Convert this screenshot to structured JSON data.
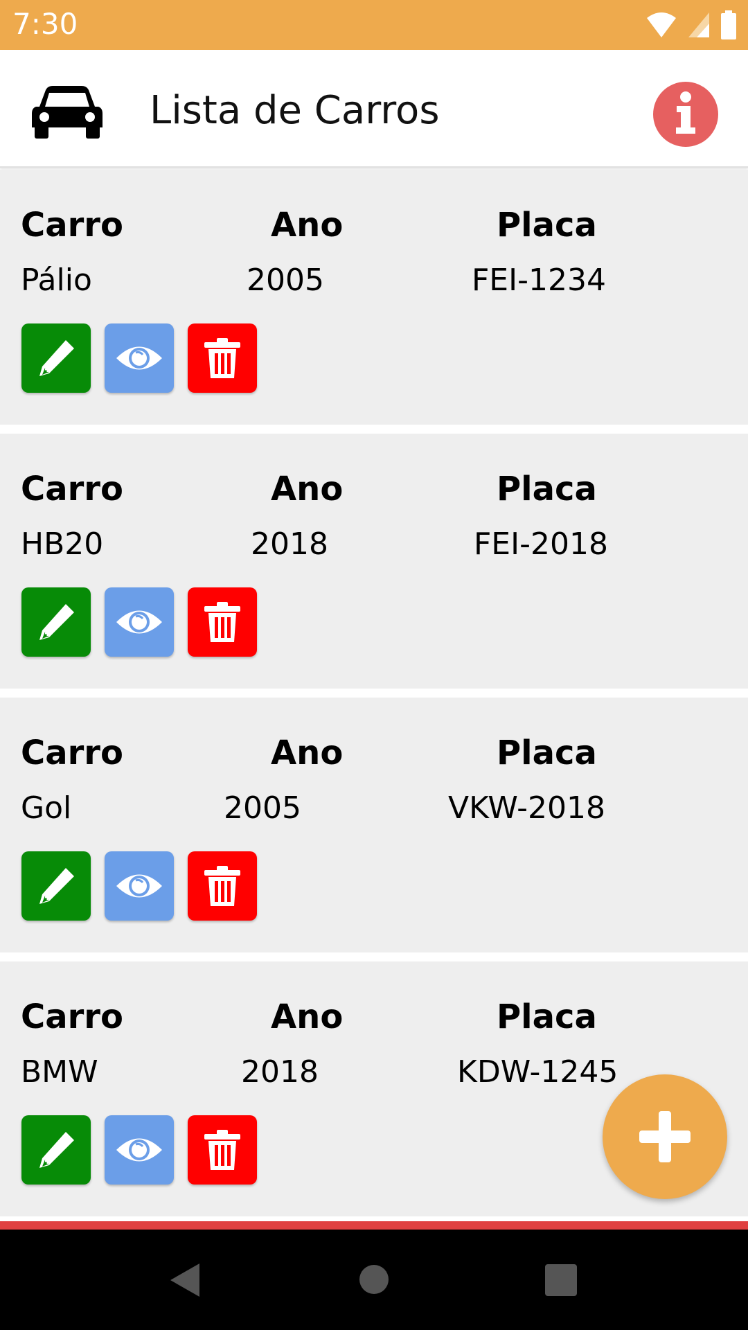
{
  "status_bar": {
    "time": "7:30"
  },
  "app_bar": {
    "title": "Lista de Carros"
  },
  "headers": {
    "car": "Carro",
    "year": "Ano",
    "plate": "Placa"
  },
  "cars": [
    {
      "car": "Pálio",
      "year": "2005",
      "plate": "FEI-1234"
    },
    {
      "car": "HB20",
      "year": "2018",
      "plate": "FEI-2018"
    },
    {
      "car": "Gol",
      "year": "2005",
      "plate": "VKW-2018"
    },
    {
      "car": "BMW",
      "year": "2018",
      "plate": "KDW-1245"
    }
  ],
  "colors": {
    "accent": "#eeaa4d",
    "edit": "#078b07",
    "view": "#6b9ee8",
    "delete": "#ff0000",
    "info": "#e66060"
  },
  "icons": {
    "app": "car-icon",
    "info": "info-icon",
    "edit": "pencil-icon",
    "view": "eye-icon",
    "delete": "trash-icon",
    "fab": "plus-icon"
  }
}
